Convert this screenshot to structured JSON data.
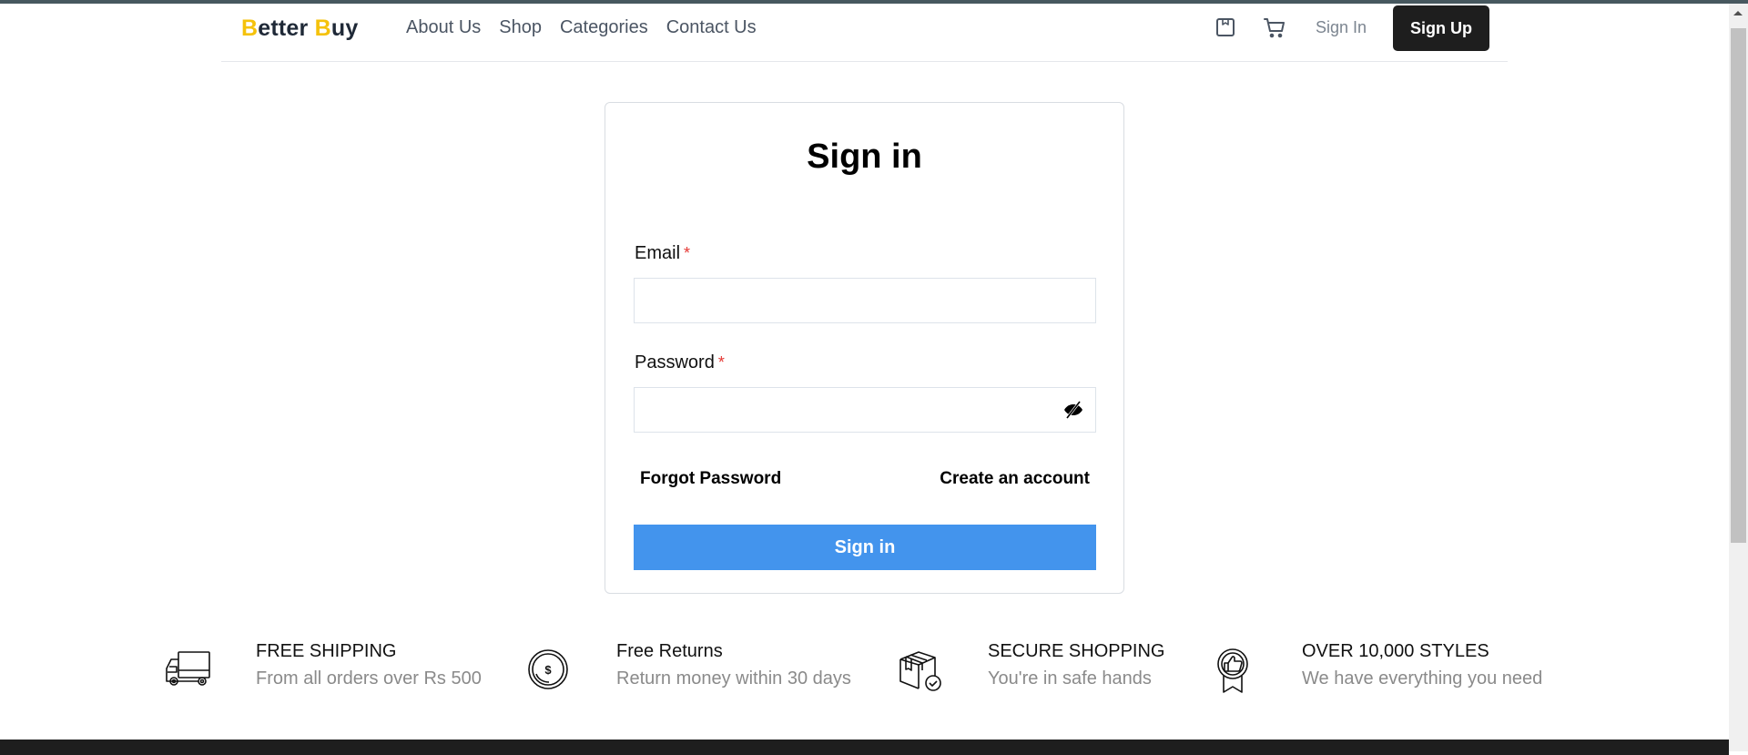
{
  "brand": {
    "first_letter": "B",
    "first_rest": "etter",
    "second_letter": "B",
    "second_rest": "uy",
    "accent_color": "#f5c20b"
  },
  "nav": {
    "links": [
      {
        "label": "About Us"
      },
      {
        "label": "Shop"
      },
      {
        "label": "Categories"
      },
      {
        "label": "Contact Us"
      }
    ],
    "icons": [
      "wishlist-box-icon",
      "cart-icon"
    ],
    "signin_label": "Sign In",
    "signup_label": "Sign Up"
  },
  "signin_form": {
    "title": "Sign in",
    "email": {
      "label": "Email",
      "required_mark": "*",
      "value": "",
      "placeholder": ""
    },
    "password": {
      "label": "Password",
      "required_mark": "*",
      "value": "",
      "placeholder": "",
      "toggle_icon": "eye-slash-icon"
    },
    "forgot_label": "Forgot Password",
    "create_label": "Create an account",
    "submit_label": "Sign in",
    "submit_color": "#4394ed"
  },
  "features": [
    {
      "icon": "truck-icon",
      "title": "FREE SHIPPING",
      "subtitle": "From all orders over Rs 500"
    },
    {
      "icon": "coin-icon",
      "title": "Free Returns",
      "subtitle": "Return money within 30 days"
    },
    {
      "icon": "secure-box-icon",
      "title": "SECURE SHOPPING",
      "subtitle": "You're in safe hands"
    },
    {
      "icon": "badge-thumbs-up-icon",
      "title": "OVER 10,000 STYLES",
      "subtitle": "We have everything you need"
    }
  ]
}
